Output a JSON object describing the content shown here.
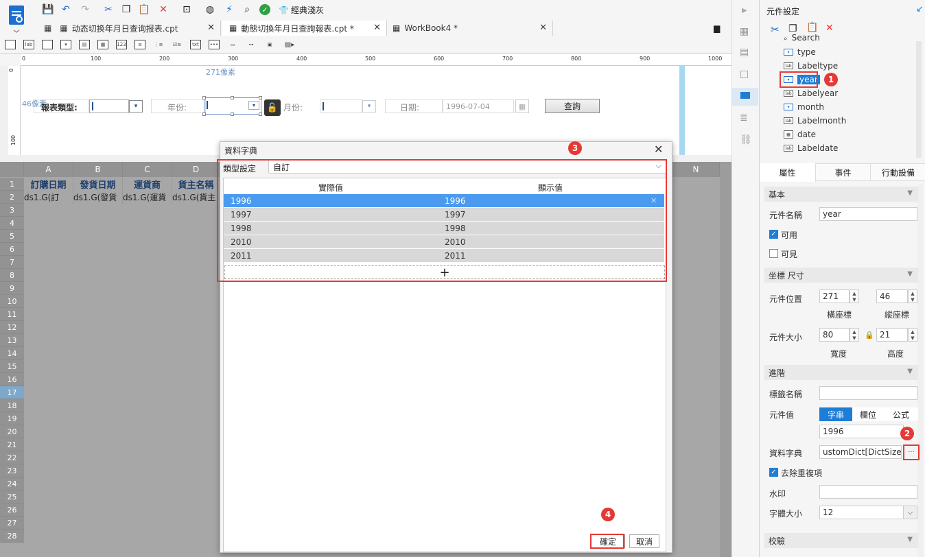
{
  "toolbar": {
    "theme_label": "經典淺灰",
    "tabs": [
      {
        "label": "动态切换年月日查询报表.cpt"
      },
      {
        "label": "動態切換年月日查詢報表.cpt *"
      },
      {
        "label": "WorkBook4 *"
      }
    ]
  },
  "ruler": {
    "ticks": [
      "0",
      "100",
      "200",
      "300",
      "400",
      "500",
      "600",
      "700",
      "800",
      "900",
      "1000"
    ],
    "vticks": [
      "0",
      "100"
    ]
  },
  "design": {
    "px_top_label": "271像素",
    "px_left_label": "46像素",
    "report_type_label": "報表類型:",
    "year_label": "年份:",
    "month_label": "月份:",
    "date_label": "日期:",
    "date_value": "1996-07-04",
    "query_button": "查詢"
  },
  "sheet": {
    "columns": [
      "A",
      "B",
      "C",
      "D",
      "N"
    ],
    "rows": [
      "1",
      "2",
      "3",
      "4",
      "5",
      "6",
      "7",
      "8",
      "9",
      "10",
      "11",
      "12",
      "13",
      "14",
      "15",
      "16",
      "17",
      "18",
      "19",
      "20",
      "21",
      "22",
      "23",
      "24",
      "25",
      "26",
      "27",
      "28"
    ],
    "header_cells": [
      "訂購日期",
      "發貨日期",
      "運貨商",
      "貨主名稱"
    ],
    "data_cells": [
      "ds1.G(訂",
      "ds1.G(發貨",
      "ds1.G(運貨",
      "ds1.G(貨主"
    ]
  },
  "dialog": {
    "title": "資料字典",
    "type_label": "類型設定",
    "type_value": "自訂",
    "col_actual": "實際值",
    "col_display": "顯示值",
    "rows": [
      {
        "actual": "1996",
        "display": "1996"
      },
      {
        "actual": "1997",
        "display": "1997"
      },
      {
        "actual": "1998",
        "display": "1998"
      },
      {
        "actual": "2010",
        "display": "2010"
      },
      {
        "actual": "2011",
        "display": "2011"
      }
    ],
    "add_symbol": "+",
    "ok_button": "確定",
    "cancel_button": "取消"
  },
  "panel": {
    "title": "元件設定",
    "tree": [
      "Search",
      "type",
      "Labeltype",
      "year",
      "Labelyear",
      "month",
      "Labelmonth",
      "date",
      "Labeldate"
    ],
    "tabs": [
      "屬性",
      "事件",
      "行動設備"
    ],
    "section_basic": "基本",
    "widget_name_label": "元件名稱",
    "widget_name_value": "year",
    "enabled_label": "可用",
    "visible_label": "可見",
    "section_coord": "坐標 尺寸",
    "position_label": "元件位置",
    "pos_x": "271",
    "pos_y": "46",
    "x_caption": "橫座標",
    "y_caption": "縱座標",
    "size_label": "元件大小",
    "width": "80",
    "height": "21",
    "w_caption": "寬度",
    "h_caption": "高度",
    "section_adv": "進階",
    "tag_label": "標籤名稱",
    "value_label": "元件值",
    "value_tabs": [
      "字串",
      "欄位",
      "公式"
    ],
    "value": "1996",
    "dict_label": "資料字典",
    "dict_value": "ustomDict[DictSize:5]",
    "dict_btn": "···",
    "dedupe_label": "去除重複項",
    "watermark_label": "水印",
    "font_size_label": "字體大小",
    "font_size_value": "12",
    "section_verify": "校驗"
  },
  "badges": [
    "1",
    "2",
    "3",
    "4"
  ],
  "colors": {
    "accent": "#1e7dd6",
    "selection": "#4a9bef",
    "highlight": "#e53935"
  }
}
